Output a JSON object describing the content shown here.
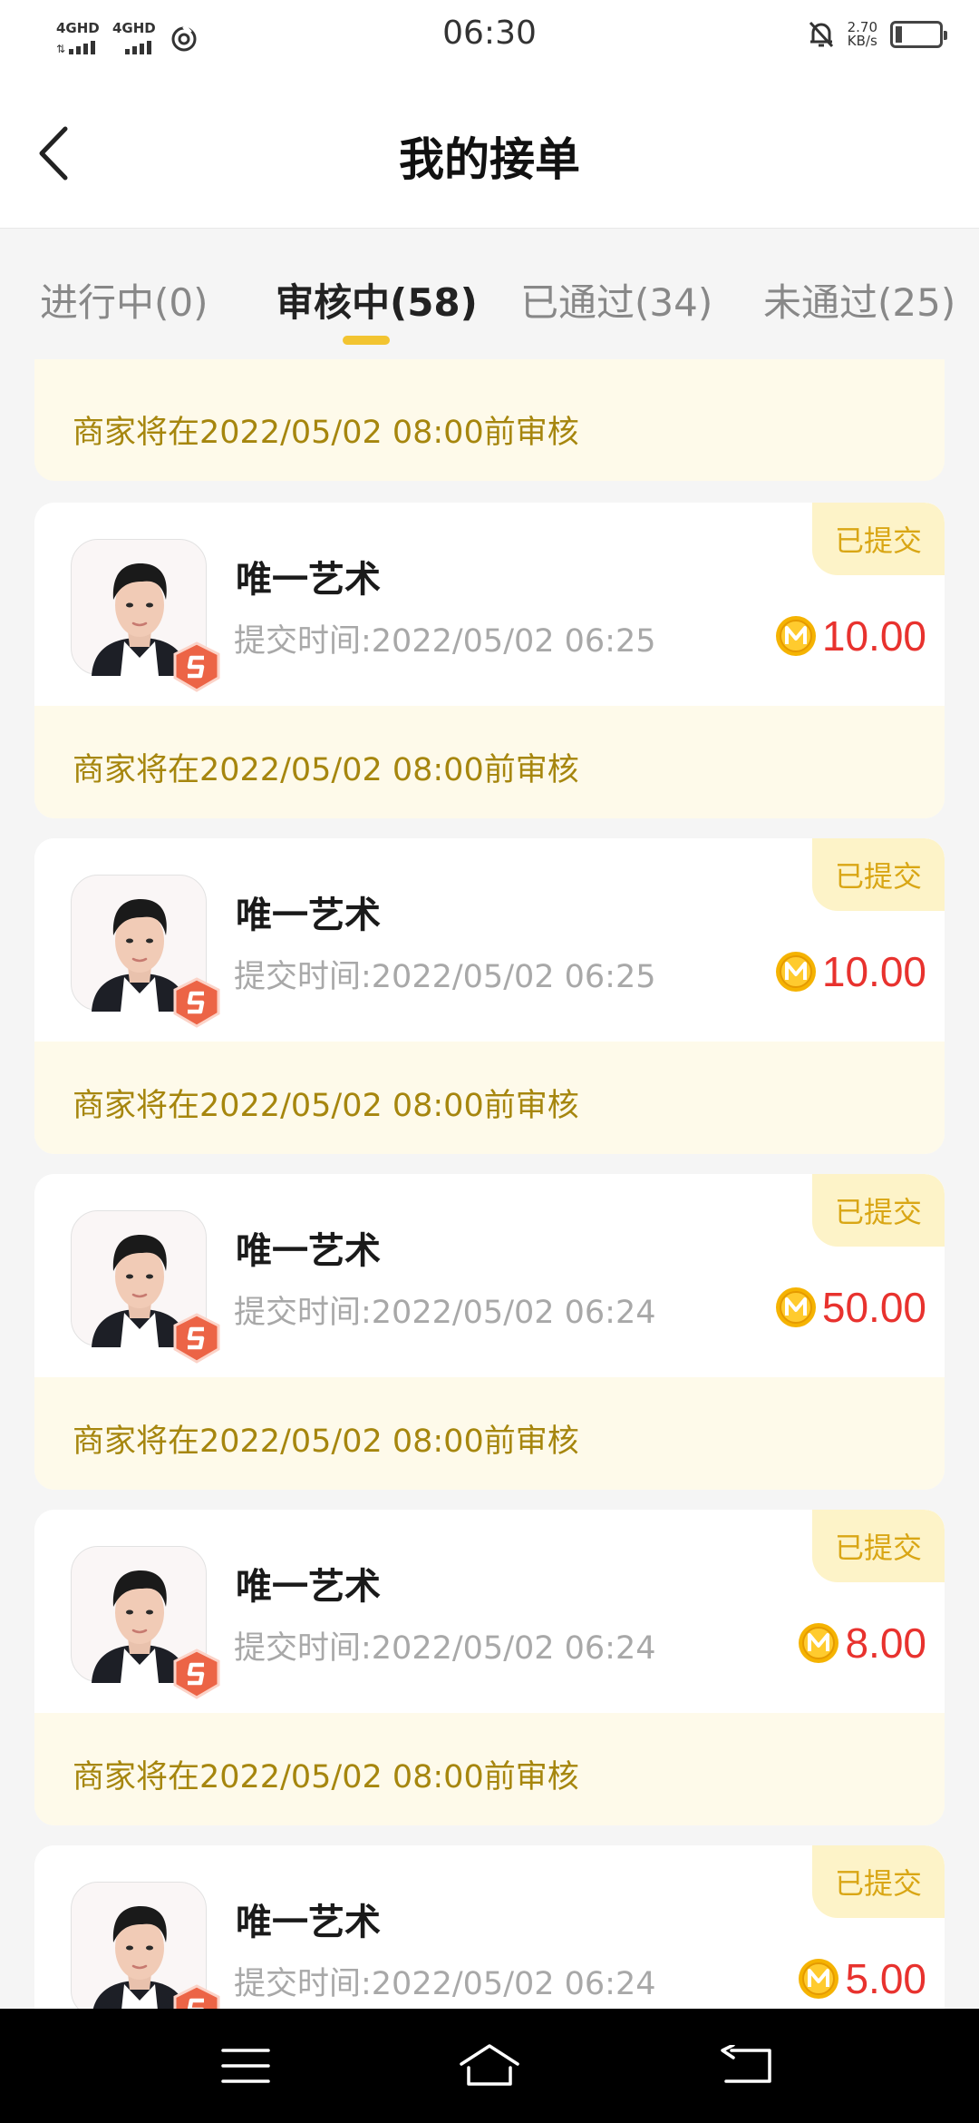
{
  "status_bar": {
    "signal1_label": "4GHD",
    "signal2_label": "4GHD",
    "time": "06:30",
    "speed_value": "2.70",
    "speed_unit": "KB/s",
    "battery_level": 0.12
  },
  "header": {
    "title": "我的接单"
  },
  "tabs": [
    {
      "label": "进行中(0)",
      "active": false
    },
    {
      "label": "审核中(58)",
      "active": true
    },
    {
      "label": "已通过(34)",
      "active": false
    },
    {
      "label": "未通过(25)",
      "active": false
    }
  ],
  "partial_card": {
    "notice": "商家将在2022/05/02 08:00前审核"
  },
  "orders": [
    {
      "status": "已提交",
      "merchant": "唯一艺术",
      "submit_time": "提交时间:2022/05/02 06:25",
      "amount": "10.00",
      "notice": "商家将在2022/05/02 08:00前审核"
    },
    {
      "status": "已提交",
      "merchant": "唯一艺术",
      "submit_time": "提交时间:2022/05/02 06:25",
      "amount": "10.00",
      "notice": "商家将在2022/05/02 08:00前审核"
    },
    {
      "status": "已提交",
      "merchant": "唯一艺术",
      "submit_time": "提交时间:2022/05/02 06:24",
      "amount": "50.00",
      "notice": "商家将在2022/05/02 08:00前审核"
    },
    {
      "status": "已提交",
      "merchant": "唯一艺术",
      "submit_time": "提交时间:2022/05/02 06:24",
      "amount": "8.00",
      "notice": "商家将在2022/05/02 08:00前审核"
    },
    {
      "status": "已提交",
      "merchant": "唯一艺术",
      "submit_time": "提交时间:2022/05/02 06:24",
      "amount": "5.00",
      "notice": ""
    }
  ],
  "icons": {
    "back": "chevron-left-icon",
    "coin": "m-coin-icon",
    "badge": "s-badge-icon",
    "nav_menu": "menu-icon",
    "nav_home": "home-icon",
    "nav_back": "return-icon"
  },
  "colors": {
    "accent": "#f2c431",
    "amount": "#e8322e",
    "notice_text": "#a6860e",
    "notice_bg": "#fefaea",
    "tag_bg": "#fdf3c8",
    "tag_text": "#d9a615"
  }
}
